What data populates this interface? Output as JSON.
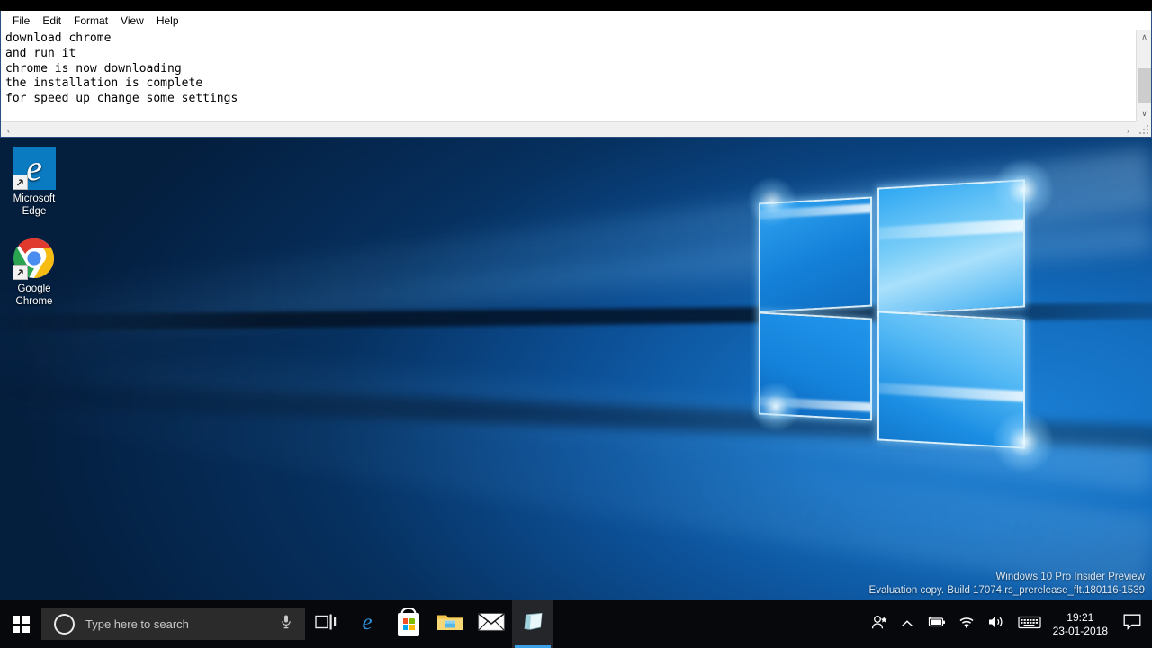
{
  "window": {
    "app": "Notepad",
    "menus": [
      {
        "label": "File",
        "name": "menu-file"
      },
      {
        "label": "Edit",
        "name": "menu-edit"
      },
      {
        "label": "Format",
        "name": "menu-format"
      },
      {
        "label": "View",
        "name": "menu-view"
      },
      {
        "label": "Help",
        "name": "menu-help"
      }
    ],
    "text": "download chrome\nand run it\nchrome is now downloading\nthe installation is complete\nfor speed up change some settings",
    "scroll": {
      "up_arrow": "∧",
      "down_arrow": "∨",
      "left_arrow": "‹",
      "right_arrow": "›"
    }
  },
  "desktop": {
    "icons": [
      {
        "label_line1": "Microsoft",
        "label_line2": "Edge",
        "icon": "edge-icon"
      },
      {
        "label_line1": "Google",
        "label_line2": "Chrome",
        "icon": "chrome-icon"
      }
    ],
    "watermark": {
      "line1": "Windows 10 Pro Insider Preview",
      "line2": "Evaluation copy. Build 17074.rs_prerelease_flt.180116-1539"
    }
  },
  "taskbar": {
    "start": {
      "label": "Start",
      "icon": "windows-logo-icon"
    },
    "search": {
      "placeholder": "Type here to search",
      "value": "",
      "cortana_icon": "cortana-ring-icon",
      "mic_icon": "microphone-icon"
    },
    "buttons": [
      {
        "name": "taskview",
        "label": "Task View",
        "icon": "task-view-icon",
        "active": false
      },
      {
        "name": "edge",
        "label": "Microsoft Edge",
        "icon": "edge-icon",
        "active": false
      },
      {
        "name": "store",
        "label": "Microsoft Store",
        "icon": "store-icon",
        "active": false
      },
      {
        "name": "explorer",
        "label": "File Explorer",
        "icon": "folder-icon",
        "active": false
      },
      {
        "name": "mail",
        "label": "Mail",
        "icon": "mail-icon",
        "active": false
      },
      {
        "name": "notepad",
        "label": "Untitled - Notepad",
        "icon": "notepad-icon",
        "active": true
      }
    ],
    "tray": [
      {
        "name": "people",
        "label": "People",
        "icon": "people-icon"
      },
      {
        "name": "show-hidden",
        "label": "Show hidden icons",
        "icon": "chevron-up-icon"
      },
      {
        "name": "battery",
        "label": "Battery",
        "icon": "battery-icon"
      },
      {
        "name": "network",
        "label": "Network",
        "icon": "wifi-icon"
      },
      {
        "name": "volume",
        "label": "Volume",
        "icon": "speaker-icon"
      },
      {
        "name": "keyboard",
        "label": "Touch keyboard",
        "icon": "keyboard-icon"
      }
    ],
    "clock": {
      "time": "19:21",
      "date": "23-01-2018"
    },
    "action_center": {
      "label": "Action Center",
      "icon": "speech-bubble-icon"
    }
  },
  "colors": {
    "accent": "#3aa0e8",
    "taskbar_bg": "#06080c",
    "search_bg": "#2b2b2b",
    "edge_blue": "#0b7bc1",
    "window_border": "#2a4f80"
  }
}
